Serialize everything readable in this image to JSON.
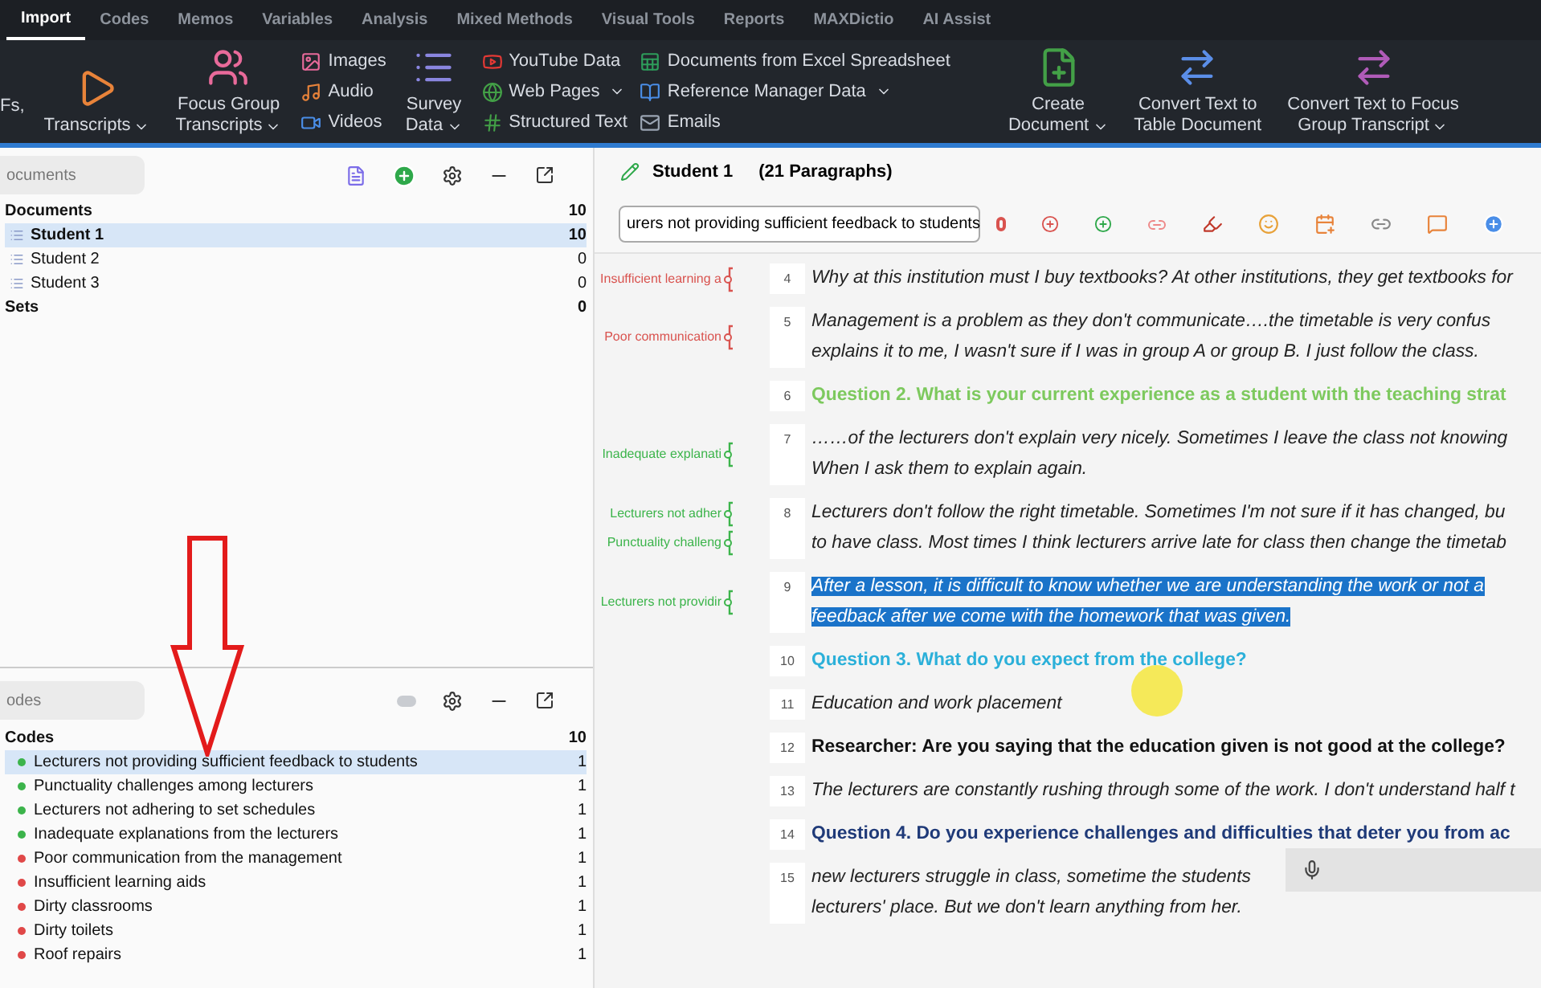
{
  "menu_tabs": [
    {
      "label": "Import",
      "selected": true
    },
    {
      "label": "Codes",
      "selected": false
    },
    {
      "label": "Memos",
      "selected": false
    },
    {
      "label": "Variables",
      "selected": false
    },
    {
      "label": "Analysis",
      "selected": false
    },
    {
      "label": "Mixed Methods",
      "selected": false
    },
    {
      "label": "Visual Tools",
      "selected": false
    },
    {
      "label": "Reports",
      "selected": false
    },
    {
      "label": "MAXDictio",
      "selected": false
    },
    {
      "label": "AI Assist",
      "selected": false
    }
  ],
  "ribbon": {
    "cut_label": "Fs,",
    "large_buttons_1": [
      {
        "kind": "transcripts",
        "lines": [
          "Transcripts"
        ],
        "dropdown": true
      },
      {
        "kind": "focus",
        "lines": [
          "Focus Group",
          "Transcripts"
        ],
        "dropdown": true
      }
    ],
    "media": [
      {
        "kind": "images",
        "label": "Images"
      },
      {
        "kind": "audio",
        "label": "Audio"
      },
      {
        "kind": "videos",
        "label": "Videos"
      }
    ],
    "survey": {
      "lines": [
        "Survey",
        "Data"
      ],
      "dropdown": true
    },
    "web": [
      {
        "kind": "youtube",
        "label": "YouTube Data",
        "dropdown": false
      },
      {
        "kind": "web",
        "label": "Web Pages",
        "dropdown": true
      },
      {
        "kind": "hash",
        "label": "Structured Text",
        "dropdown": false
      }
    ],
    "other": [
      {
        "kind": "excel",
        "label": "Documents from Excel Spreadsheet",
        "dropdown": false
      },
      {
        "kind": "reference",
        "label": "Reference Manager Data",
        "dropdown": true
      },
      {
        "kind": "email",
        "label": "Emails",
        "dropdown": false
      }
    ],
    "large_buttons_2": [
      {
        "kind": "create",
        "lines": [
          "Create",
          "Document"
        ],
        "dropdown": true
      },
      {
        "kind": "table",
        "lines": [
          "Convert Text to",
          "Table Document"
        ],
        "dropdown": false
      },
      {
        "kind": "focusconv",
        "lines": [
          "Convert Text to Focus",
          "Group Transcript"
        ],
        "dropdown": true
      }
    ]
  },
  "documents_panel": {
    "search_placeholder": "ocuments",
    "root": {
      "label": "Documents",
      "count": "10"
    },
    "items": [
      {
        "label": "Student 1",
        "count": "10",
        "selected": true
      },
      {
        "label": "Student 2",
        "count": "0",
        "selected": false
      },
      {
        "label": "Student 3",
        "count": "0",
        "selected": false
      }
    ],
    "sets": {
      "label": "Sets",
      "count": "0"
    }
  },
  "codes_panel": {
    "search_placeholder": "odes",
    "root": {
      "label": "Codes",
      "count": "10"
    },
    "items": [
      {
        "label": "Lecturers not providing sufficient feedback to students",
        "count": "1",
        "color": "#3cb44b",
        "selected": true
      },
      {
        "label": "Punctuality challenges among lecturers",
        "count": "1",
        "color": "#3cb44b",
        "selected": false
      },
      {
        "label": "Lecturers not adhering to set schedules",
        "count": "1",
        "color": "#3cb44b",
        "selected": false
      },
      {
        "label": "Inadequate explanations from the lecturers",
        "count": "1",
        "color": "#3cb44b",
        "selected": false
      },
      {
        "label": "Poor communication from the management",
        "count": "1",
        "color": "#e04848",
        "selected": false
      },
      {
        "label": "Insufficient learning aids",
        "count": "1",
        "color": "#e04848",
        "selected": false
      },
      {
        "label": "Dirty classrooms",
        "count": "1",
        "color": "#e04848",
        "selected": false
      },
      {
        "label": "Dirty toilets",
        "count": "1",
        "color": "#e04848",
        "selected": false
      },
      {
        "label": "Roof repairs",
        "count": "1",
        "color": "#e04848",
        "selected": false
      }
    ]
  },
  "document": {
    "title": "Student 1",
    "paragraph_count": "(21 Paragraphs)",
    "code_select": "urers not providing sufficient feedback to students",
    "paragraphs": [
      {
        "number": "4",
        "kind": "answer",
        "selected": false,
        "codes": [
          {
            "label": "Insufficient learning a",
            "color": "#d9534f"
          }
        ],
        "lines": [
          "Why at this institution must I buy textbooks? At other institutions, they get textbooks for"
        ]
      },
      {
        "number": "5",
        "kind": "answer",
        "selected": false,
        "codes": [
          {
            "label": "Poor communication",
            "color": "#d9534f"
          }
        ],
        "lines": [
          " Management is a problem as they don't communicate….the timetable is very confus",
          "explains it to me, I wasn't sure if I was in group A or group B. I just follow the class."
        ]
      },
      {
        "number": "6",
        "kind": "question",
        "color": "#7dc95e",
        "selected": false,
        "lines": [
          "Question 2. What is your current experience as a student with the teaching strat"
        ]
      },
      {
        "number": "7",
        "kind": "answer",
        "selected": false,
        "codes": [
          {
            "label": "Inadequate explanati",
            "color": "#3cb44b"
          }
        ],
        "lines": [
          "……of the lecturers don't explain very nicely. Sometimes I leave the class not knowing",
          "When I ask them to explain again."
        ]
      },
      {
        "number": "8",
        "kind": "answer",
        "selected": false,
        "codes": [
          {
            "label": "Lecturers not adher",
            "color": "#3cb44b"
          },
          {
            "label": "Punctuality challeng",
            "color": "#3cb44b"
          }
        ],
        "lines": [
          "Lecturers don't follow the right timetable. Sometimes I'm not sure if it has changed, bu",
          "to have class. Most times I think lecturers arrive late for class then change the timetab"
        ]
      },
      {
        "number": "9",
        "kind": "answer",
        "selected": true,
        "codes": [
          {
            "label": "Lecturers not providir",
            "color": "#3cb44b"
          }
        ],
        "lines": [
          "After a lesson, it is difficult to know whether we are understanding the work or not a",
          "feedback after we come with the homework that was given."
        ]
      },
      {
        "number": "10",
        "kind": "question",
        "color": "#2bb0d9",
        "selected": false,
        "lines": [
          "Question 3. What do you expect from the college?"
        ]
      },
      {
        "number": "11",
        "kind": "answer",
        "selected": false,
        "lines": [
          "Education and work placement"
        ]
      },
      {
        "number": "12",
        "kind": "researcher",
        "selected": false,
        "lines": [
          "Researcher: Are you saying that the education given is not good at the college?"
        ]
      },
      {
        "number": "13",
        "kind": "answer",
        "selected": false,
        "lines": [
          "The lecturers are constantly rushing through some of the work. I don't understand half t"
        ]
      },
      {
        "number": "14",
        "kind": "question",
        "color": "#1f3a78",
        "selected": false,
        "lines": [
          "Question 4. Do you experience challenges and difficulties that deter you from ac"
        ]
      },
      {
        "number": "15",
        "kind": "answer",
        "selected": false,
        "lines": [
          "new lecturers struggle in class, sometime the students",
          "lecturers' place. But we don't learn anything from her."
        ]
      }
    ]
  }
}
